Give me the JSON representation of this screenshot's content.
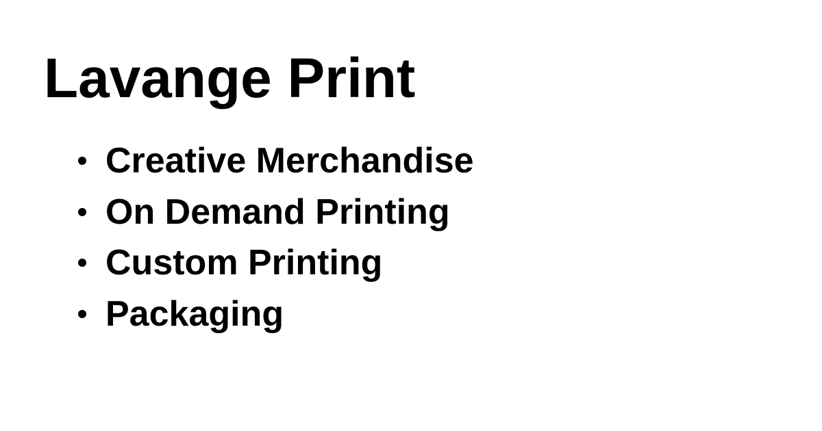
{
  "title": "Lavange Print",
  "services": [
    {
      "label": "Creative Merchandise"
    },
    {
      "label": "On Demand Printing"
    },
    {
      "label": "Custom Printing"
    },
    {
      "label": "Packaging"
    }
  ]
}
